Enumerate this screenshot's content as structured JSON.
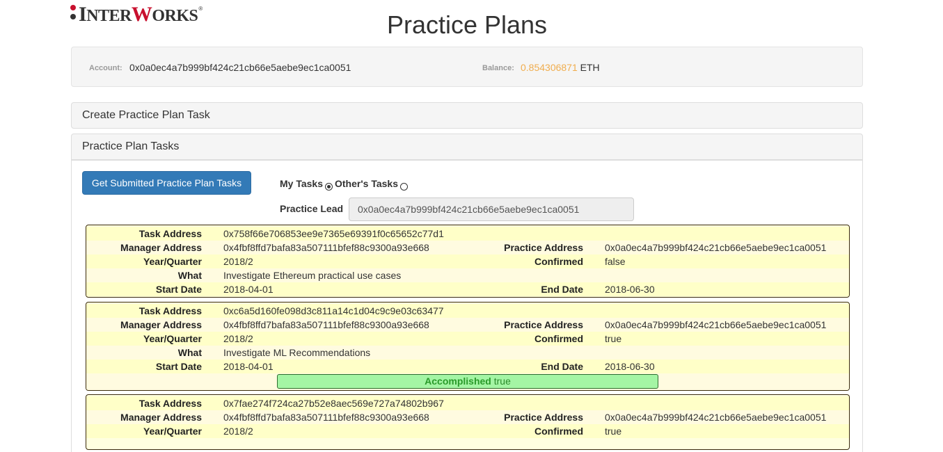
{
  "logo": {
    "brand_text_1": "I",
    "brand_text_2": "NTER",
    "brand_text_3": "W",
    "brand_text_4": "ORKS",
    "registered": "®"
  },
  "page_title": "Practice Plans",
  "account": {
    "label": "Account:",
    "value": "0x0a0ec4a7b999bf424c21cb66e5aebe9ec1ca0051"
  },
  "balance": {
    "label": "Balance:",
    "value": "0.854306871",
    "unit": "ETH"
  },
  "panels": {
    "create": "Create Practice Plan Task",
    "tasks": "Practice Plan Tasks"
  },
  "controls": {
    "get_button": "Get Submitted Practice Plan Tasks",
    "my_tasks": "My Tasks",
    "others_tasks": "Other's Tasks",
    "practice_lead_label": "Practice Lead",
    "practice_lead_value": "0x0a0ec4a7b999bf424c21cb66e5aebe9ec1ca0051"
  },
  "field_labels": {
    "task_address": "Task Address",
    "manager_address": "Manager Address",
    "practice_address": "Practice Address",
    "year_quarter": "Year/Quarter",
    "confirmed": "Confirmed",
    "what": "What",
    "start_date": "Start Date",
    "end_date": "End Date",
    "accomplished": "Accomplished"
  },
  "tasks": [
    {
      "task_address": "0x758f66e706853ee9e7365e69391f0c65652c77d1",
      "manager_address": "0x4fbf8ffd7bafa83a507111bfef88c9300a93e668",
      "practice_address": "0x0a0ec4a7b999bf424c21cb66e5aebe9ec1ca0051",
      "year_quarter": "2018/2",
      "confirmed": "false",
      "what": "Investigate Ethereum practical use cases",
      "start_date": "2018-04-01",
      "end_date": "2018-06-30"
    },
    {
      "task_address": "0xc6a5d160fe098d3c811a14c1d04c9c9e03c63477",
      "manager_address": "0x4fbf8ffd7bafa83a507111bfef88c9300a93e668",
      "practice_address": "0x0a0ec4a7b999bf424c21cb66e5aebe9ec1ca0051",
      "year_quarter": "2018/2",
      "confirmed": "true",
      "what": "Investigate ML Recommendations",
      "start_date": "2018-04-01",
      "end_date": "2018-06-30",
      "accomplished": "true"
    },
    {
      "task_address": "0x7fae274f724ca27b52e8aec569e727a74802b967",
      "manager_address": "0x4fbf8ffd7bafa83a507111bfef88c9300a93e668",
      "practice_address": "0x0a0ec4a7b999bf424c21cb66e5aebe9ec1ca0051",
      "year_quarter": "2018/2",
      "confirmed": "true"
    }
  ]
}
